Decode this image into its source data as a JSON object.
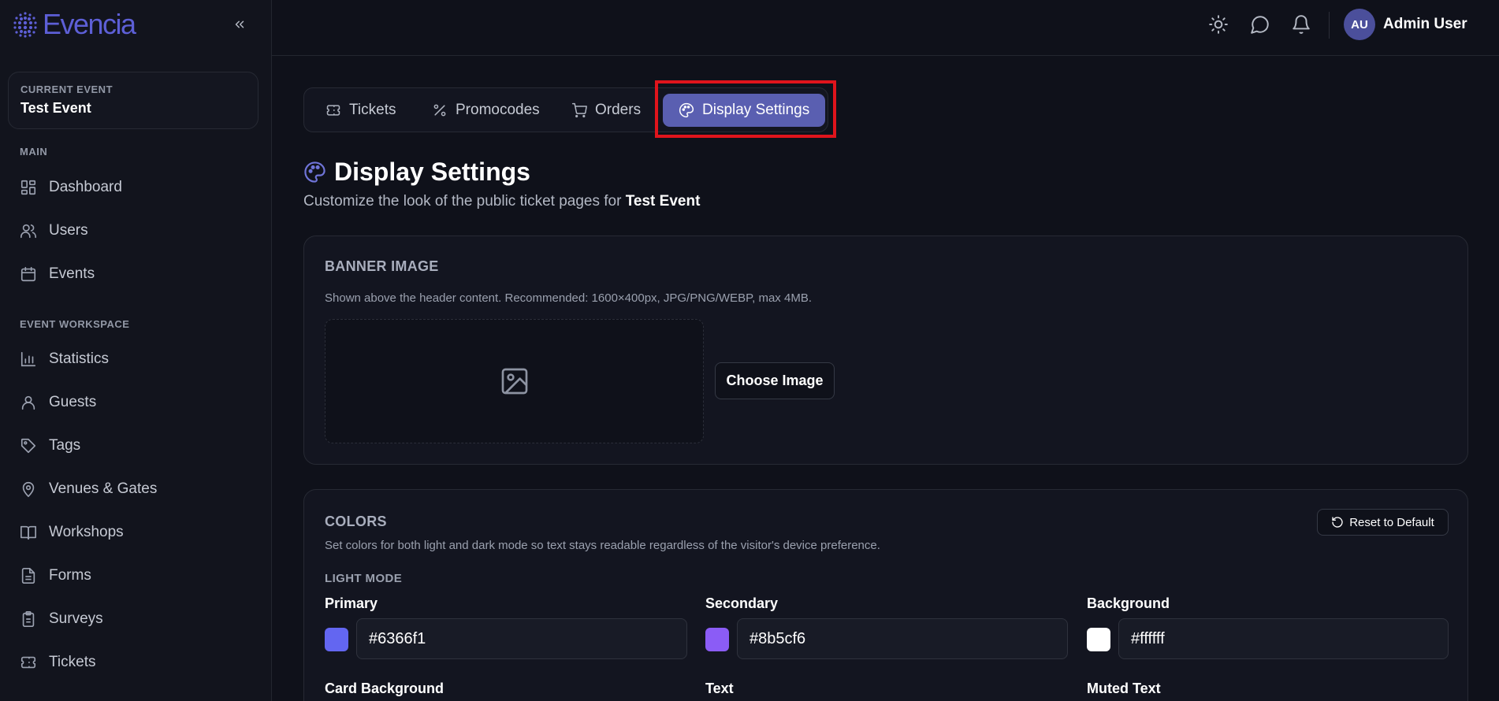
{
  "app": {
    "name": "Evencia"
  },
  "sidebar": {
    "current_event_label": "CURRENT EVENT",
    "current_event_name": "Test Event",
    "main_label": "MAIN",
    "main_items": [
      {
        "label": "Dashboard",
        "icon": "dashboard-icon"
      },
      {
        "label": "Users",
        "icon": "users-icon"
      },
      {
        "label": "Events",
        "icon": "calendar-icon"
      }
    ],
    "workspace_label": "EVENT WORKSPACE",
    "workspace_items": [
      {
        "label": "Statistics",
        "icon": "bar-chart-icon"
      },
      {
        "label": "Guests",
        "icon": "user-icon"
      },
      {
        "label": "Tags",
        "icon": "tag-icon"
      },
      {
        "label": "Venues & Gates",
        "icon": "map-pin-icon"
      },
      {
        "label": "Workshops",
        "icon": "book-icon"
      },
      {
        "label": "Forms",
        "icon": "file-text-icon"
      },
      {
        "label": "Surveys",
        "icon": "clipboard-icon"
      },
      {
        "label": "Tickets",
        "icon": "ticket-icon"
      }
    ]
  },
  "header": {
    "user_initials": "AU",
    "user_name": "Admin User"
  },
  "tabs": [
    {
      "label": "Tickets",
      "icon": "ticket-icon",
      "active": false
    },
    {
      "label": "Promocodes",
      "icon": "percent-icon",
      "active": false
    },
    {
      "label": "Orders",
      "icon": "cart-icon",
      "active": false
    },
    {
      "label": "Display Settings",
      "icon": "palette-icon",
      "active": true
    }
  ],
  "page": {
    "title": "Display Settings",
    "subtitle_prefix": "Customize the look of the public ticket pages for",
    "subtitle_event": "Test Event"
  },
  "banner": {
    "title": "BANNER IMAGE",
    "description": "Shown above the header content. Recommended: 1600×400px, JPG/PNG/WEBP, max 4MB.",
    "choose_label": "Choose Image"
  },
  "colors": {
    "title": "COLORS",
    "description": "Set colors for both light and dark mode so text stays readable regardless of the visitor's device preference.",
    "reset_label": "Reset to Default",
    "light_mode_label": "LIGHT MODE",
    "fields": [
      {
        "label": "Primary",
        "value": "#6366f1"
      },
      {
        "label": "Secondary",
        "value": "#8b5cf6"
      },
      {
        "label": "Background",
        "value": "#ffffff"
      }
    ],
    "next_row_labels": [
      "Card Background",
      "Text",
      "Muted Text"
    ]
  },
  "theme": {
    "accent": "#5a5fb1",
    "highlight_border": "#e0141c",
    "background": "#0f111a"
  }
}
